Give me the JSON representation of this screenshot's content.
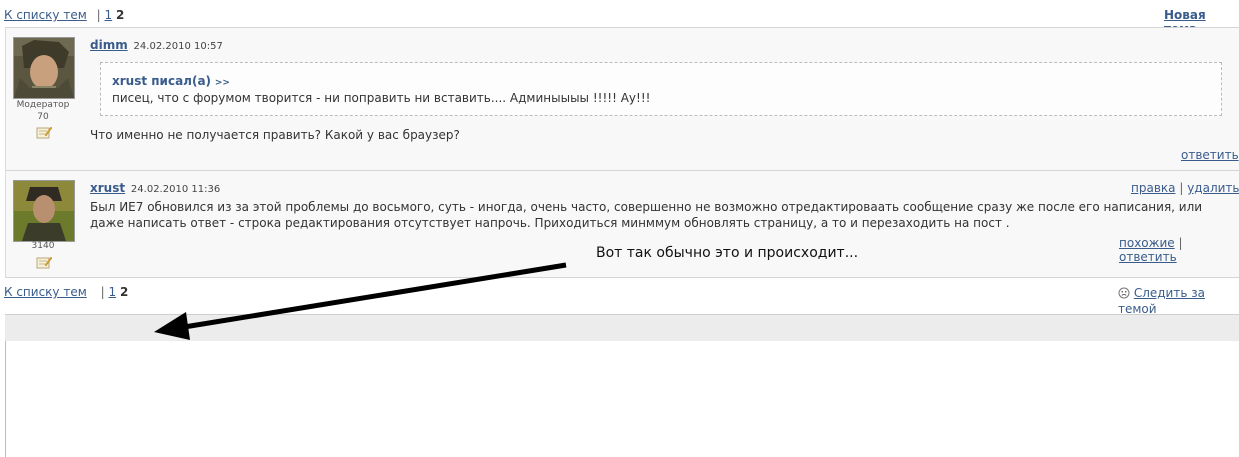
{
  "nav": {
    "back_label": "К списку тем",
    "separator": "|",
    "page_1": "1",
    "page_2": "2",
    "new_topic_label": "Новая тема",
    "follow_label": "Следить за темой"
  },
  "posts": [
    {
      "author": "dimm",
      "date": "24.02.2010 10:57",
      "rank": "Модератор",
      "count": "70",
      "quote": {
        "author": "xrust писал(а)",
        "link": ">>",
        "text": "писец, что с форумом творится - ни поправить ни вставить.... Админыыыы !!!!! Ау!!!"
      },
      "text": "Что именно не получается править? Какой у вас браузер?",
      "actions": {
        "reply": "ответить"
      }
    },
    {
      "author": "xrust",
      "date": "24.02.2010 11:36",
      "count": "3140",
      "text": "Был ИЕ7 обновился из за этой проблемы до восьмого, суть - иногда, очень часто, совершенно не возможно отредактироваать сообщение сразу же после его написания, или даже написать ответ - строка редактирования отсутствует напрочь. Приходиться минммум обновлять страницу, а то и перезаходить на пост .",
      "actions": {
        "edit": "правка",
        "delete": "удалить",
        "similar": "похожие",
        "reply": "ответить"
      }
    }
  ],
  "annotation": {
    "text": "Вот так обычно это и происходит..."
  },
  "colors": {
    "link": "#3a5c8c",
    "post_bg": "#f8f8f8",
    "bar_bg": "#ececec"
  },
  "icons": [
    "edit-pm-icon",
    "smiley-icon",
    "arrow"
  ]
}
